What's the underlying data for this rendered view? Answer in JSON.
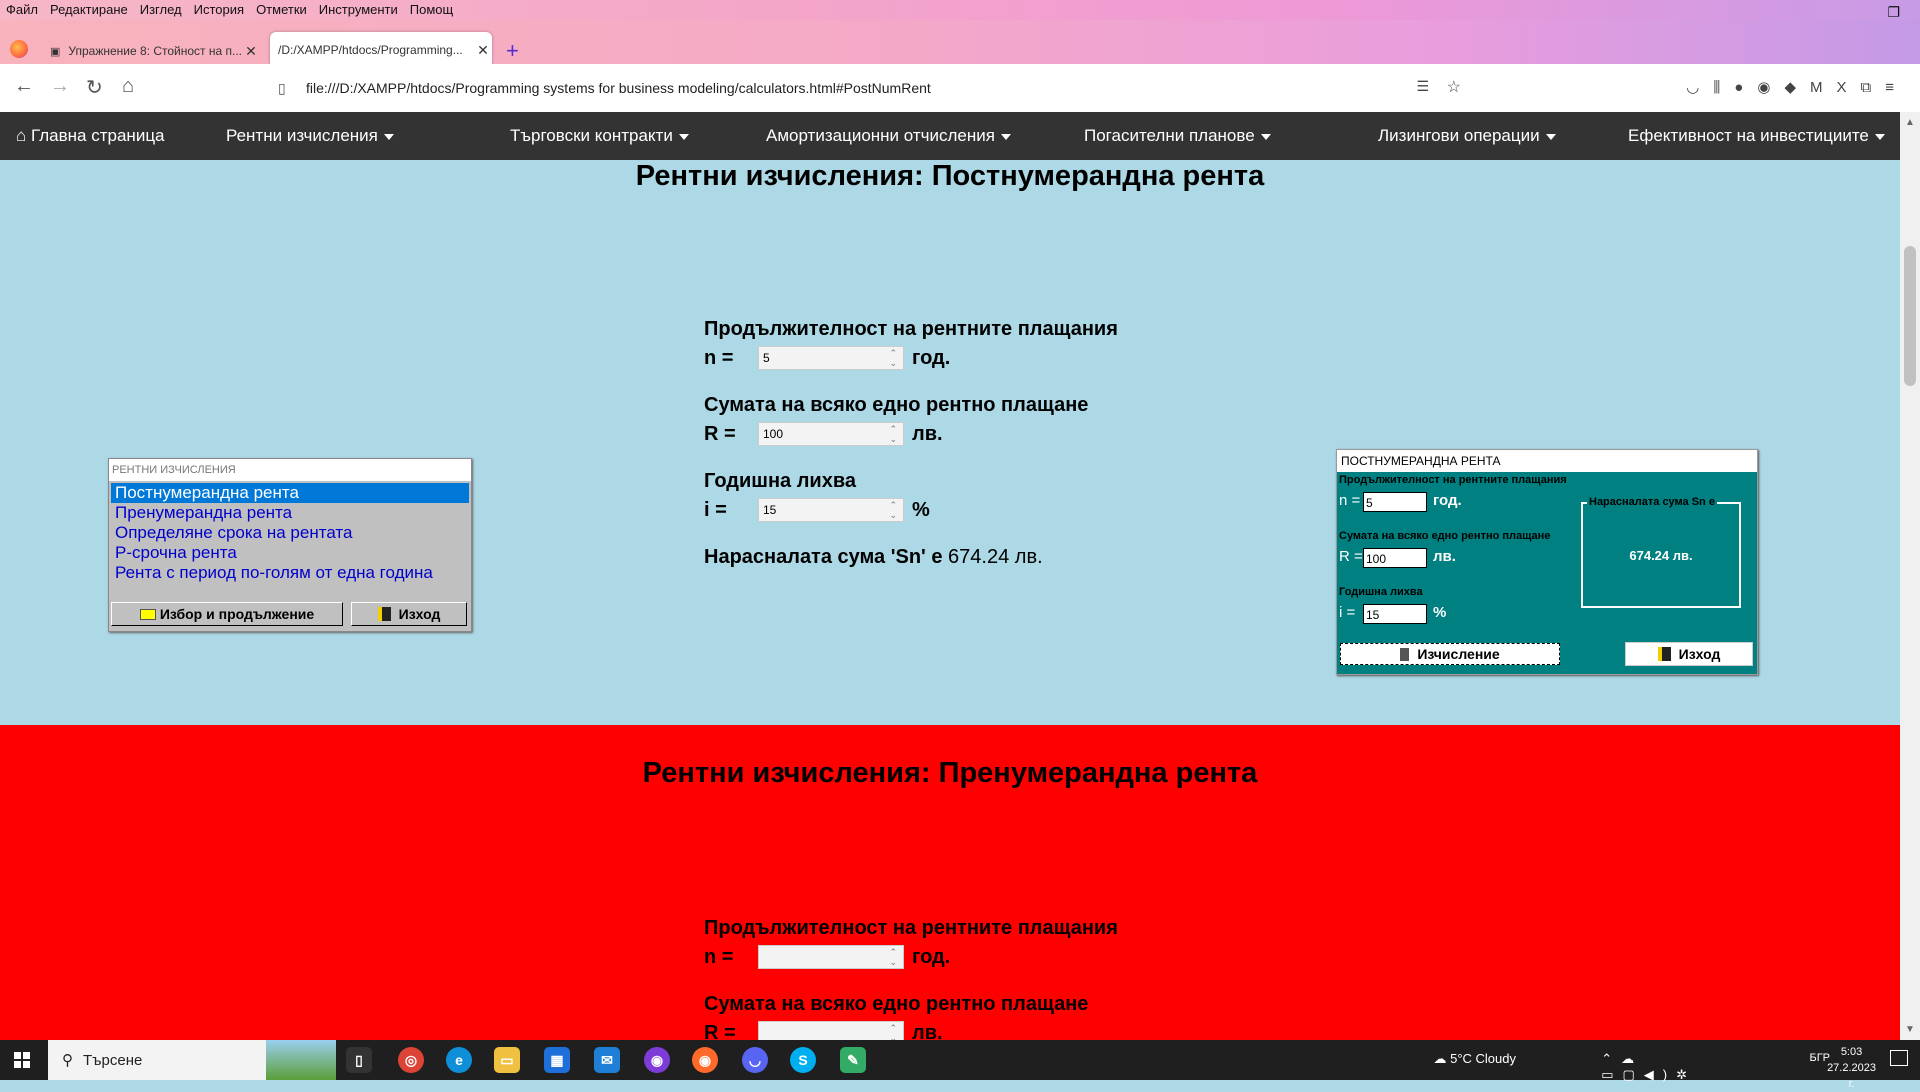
{
  "browser": {
    "menu": [
      "Файл",
      "Редактиране",
      "Изглед",
      "История",
      "Отметки",
      "Инструменти",
      "Помощ"
    ],
    "tabs": [
      {
        "title": "Упражнение 8: Стойност на п..."
      },
      {
        "title": "/D:/XAMPP/htdocs/Programming..."
      }
    ],
    "url": "file:///D:/XAMPP/htdocs/Programming systems for business modeling/calculators.html#PostNumRent"
  },
  "site_nav": {
    "home": "Главна страница",
    "items": [
      "Рентни изчисления",
      "Търговски контракти",
      "Амортизационни отчисления",
      "Погасителни планове",
      "Лизингови операции",
      "Ефективност на инвестициите"
    ]
  },
  "section1": {
    "title": "Рентни изчисления: Постнумерандна рента",
    "duration_label": "Продължителност на рентните плащания",
    "n_sym": "n =",
    "n_value": "5",
    "n_unit": "год.",
    "payment_label": "Сумата на всяко едно рентно плащане",
    "r_sym": "R =",
    "r_value": "100",
    "r_unit": "лв.",
    "rate_label": "Годишна лихва",
    "i_sym": "i =",
    "i_value": "15",
    "i_unit": "%",
    "result_label": "Нарасналата сума 'Sn' е",
    "result_value": "674.24 лв."
  },
  "listbox_window": {
    "caption": "РЕНТНИ ИЗЧИСЛЕНИЯ",
    "items": [
      "Постнумерандна рента",
      "Пренумерандна рента",
      "Определяне срока на рентата",
      "Р-срочна рента",
      "Рента с период по-голям от една година"
    ],
    "selected": "Постнумерандна рента",
    "btn_choose": "Избор и продължение",
    "btn_exit": "Изход"
  },
  "calc_window": {
    "caption": "ПОСТНУМЕРАНДНА РЕНТА",
    "duration_label": "Продължителност на рентните плащания",
    "n_sym": "n =",
    "n_value": "5",
    "n_unit": "год.",
    "payment_label": "Сумата на всяко едно рентно плащане",
    "r_sym": "R =",
    "r_value": "100",
    "r_unit": "лв.",
    "rate_label": "Годишна лихва",
    "i_sym": "i =",
    "i_value": "15",
    "i_unit": "%",
    "group_title": "Нарасналата сума Sn е",
    "group_value": "674.24 лв.",
    "btn_calc": "Изчисление",
    "btn_exit": "Изход"
  },
  "section2": {
    "title": "Рентни изчисления: Пренумерандна рента",
    "duration_label": "Продължителност на рентните плащания",
    "n_sym": "n =",
    "n_unit": "год.",
    "payment_label": "Сумата на всяко едно рентно плащане",
    "r_sym": "R =",
    "r_unit": "лв."
  },
  "taskbar": {
    "search_placeholder": "Търсене",
    "weather": "5°C  Cloudy",
    "lang": "БГР",
    "time": "5:03",
    "date": "27.2.2023 г."
  },
  "colors": {
    "section1_bg": "#add8e6",
    "section2_bg": "#ff0000",
    "nav_bg": "#333333",
    "calc_window_bg": "#008080",
    "list_selected": "#0078d7"
  }
}
